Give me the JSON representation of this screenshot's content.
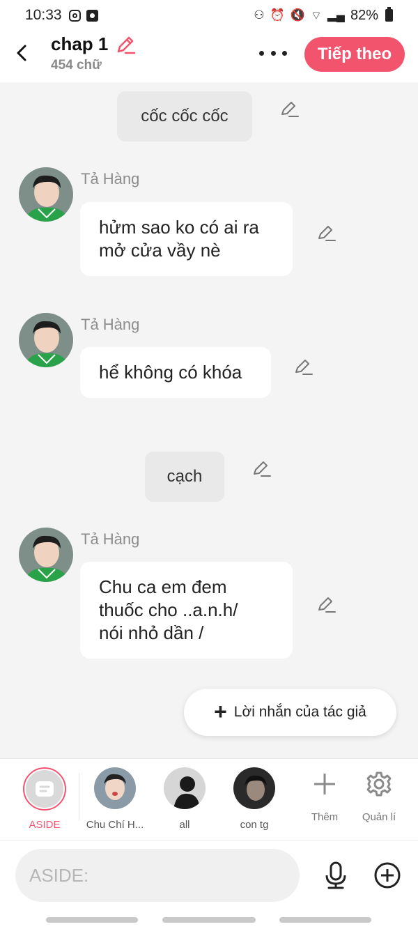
{
  "status_bar": {
    "time": "10:33",
    "battery": "82%"
  },
  "header": {
    "title": "chap 1",
    "subtitle": "454 chữ",
    "next_label": "Tiếp theo"
  },
  "messages": [
    {
      "type": "aside",
      "text": "cốc cốc cốc"
    },
    {
      "type": "character",
      "sender": "Tả Hàng",
      "text": "hửm sao ko có ai ra\nmở cửa vầy nè"
    },
    {
      "type": "character",
      "sender": "Tả Hàng",
      "text": "hể không có khóa"
    },
    {
      "type": "aside",
      "text": "cạch"
    },
    {
      "type": "character",
      "sender": "Tả Hàng",
      "text": "Chu ca em đem\nthuốc cho ..a.n.h/\nnói nhỏ dần /"
    }
  ],
  "author_note": {
    "label": "Lời nhắn của tác giả"
  },
  "characters": [
    {
      "label": "ASIDE",
      "active": true
    },
    {
      "label": "Chu Chí H..."
    },
    {
      "label": "all"
    },
    {
      "label": "con tg"
    }
  ],
  "tools": {
    "add_label": "Thêm",
    "manage_label": "Quản lí"
  },
  "input": {
    "placeholder": "ASIDE:"
  },
  "colors": {
    "accent": "#f3546d",
    "bubble": "#ffffff",
    "aside_bubble": "#e9e9e9",
    "background": "#f4f4f4"
  }
}
